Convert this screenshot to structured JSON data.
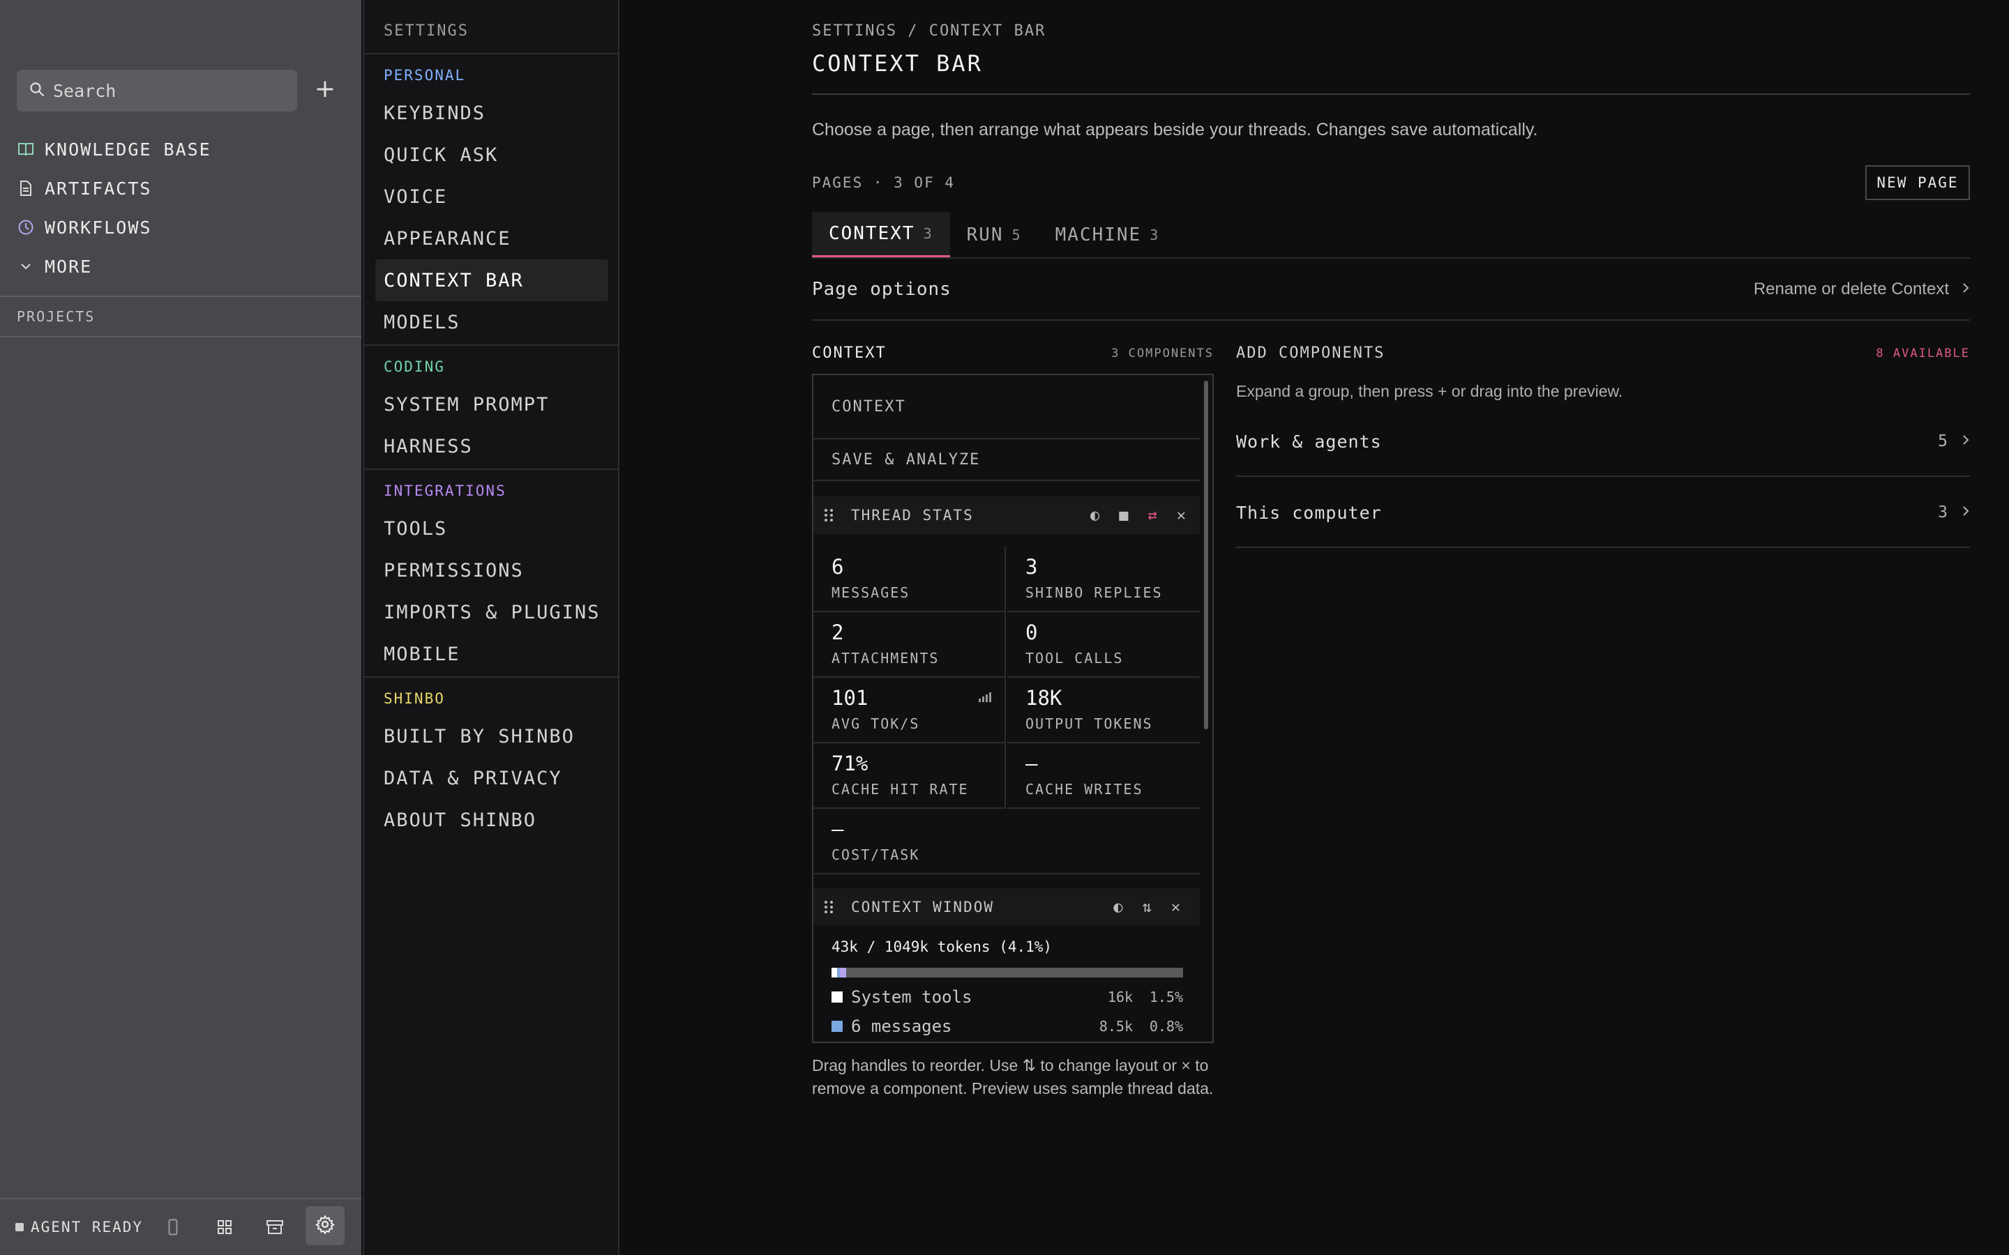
{
  "sidebar": {
    "search": {
      "placeholder": "Search"
    },
    "add_label": "+",
    "nav": [
      {
        "label": "KNOWLEDGE BASE",
        "icon": "book-icon"
      },
      {
        "label": "ARTIFACTS",
        "icon": "document-icon"
      },
      {
        "label": "WORKFLOWS",
        "icon": "clock-icon"
      },
      {
        "label": "MORE",
        "icon": "chevron-down-icon"
      }
    ],
    "projects_label": "PROJECTS",
    "status_text": "AGENT READY",
    "colors": {
      "book_icon": "#8fd6b8",
      "clock_icon": "#b7a3f0"
    }
  },
  "settings_nav": {
    "title": "SETTINGS",
    "sections": [
      {
        "label": "PERSONAL",
        "color": "#7fb0ff",
        "items": [
          "KEYBINDS",
          "QUICK ASK",
          "VOICE",
          "APPEARANCE",
          "CONTEXT BAR",
          "MODELS"
        ]
      },
      {
        "label": "CODING",
        "color": "#6fd4a8",
        "items": [
          "SYSTEM PROMPT",
          "HARNESS"
        ]
      },
      {
        "label": "INTEGRATIONS",
        "color": "#b78af0",
        "items": [
          "TOOLS",
          "PERMISSIONS",
          "IMPORTS & PLUGINS",
          "MOBILE"
        ]
      },
      {
        "label": "SHINBO",
        "color": "#e6d86a",
        "items": [
          "BUILT BY SHINBO",
          "DATA & PRIVACY",
          "ABOUT SHINBO"
        ]
      }
    ],
    "active": "CONTEXT BAR"
  },
  "main": {
    "breadcrumb": "SETTINGS / CONTEXT BAR",
    "title": "CONTEXT BAR",
    "description": "Choose a page, then arrange what appears beside your threads. Changes save automatically.",
    "pages_label": "PAGES · 3 OF 4",
    "new_page_label": "NEW PAGE",
    "tabs": [
      {
        "label": "CONTEXT",
        "count": "3"
      },
      {
        "label": "RUN",
        "count": "5"
      },
      {
        "label": "MACHINE",
        "count": "3"
      }
    ],
    "page_options_label": "Page options",
    "rename_label": "Rename or delete Context",
    "accent": "#e05a82"
  },
  "preview": {
    "title": "CONTEXT",
    "count_label": "3 COMPONENTS",
    "sections": [
      "CONTEXT",
      "SAVE & ANALYZE"
    ],
    "thread_stats": {
      "title": "THREAD STATS",
      "stats": [
        {
          "value": "6",
          "label": "MESSAGES"
        },
        {
          "value": "3",
          "label": "SHINBO REPLIES"
        },
        {
          "value": "2",
          "label": "ATTACHMENTS"
        },
        {
          "value": "0",
          "label": "TOOL CALLS"
        },
        {
          "value": "101",
          "label": "AVG TOK/S"
        },
        {
          "value": "18K",
          "label": "OUTPUT TOKENS"
        },
        {
          "value": "71%",
          "label": "CACHE HIT RATE"
        },
        {
          "value": "—",
          "label": "CACHE WRITES"
        },
        {
          "value": "—",
          "label": "COST/TASK"
        }
      ]
    },
    "context_window": {
      "title": "CONTEXT WINDOW",
      "tokens_label": "43k / 1049k tokens (4.1%)",
      "fill_fraction": 0.041,
      "rows": [
        {
          "label": "System tools",
          "tokens": "16k",
          "pct": "1.5%",
          "color": "#ffffff"
        },
        {
          "label": "6 messages",
          "tokens": "8.5k",
          "pct": "0.8%",
          "color": "#7aa7e0"
        }
      ]
    },
    "note": "Drag handles to reorder. Use ⇅ to change layout or × to remove a component. Preview uses sample thread data."
  },
  "add_components": {
    "title": "ADD COMPONENTS",
    "available_label": "8 AVAILABLE",
    "description": "Expand a group, then press + or drag into the preview.",
    "groups": [
      {
        "name": "Work & agents",
        "count": "5"
      },
      {
        "name": "This computer",
        "count": "3"
      }
    ]
  }
}
